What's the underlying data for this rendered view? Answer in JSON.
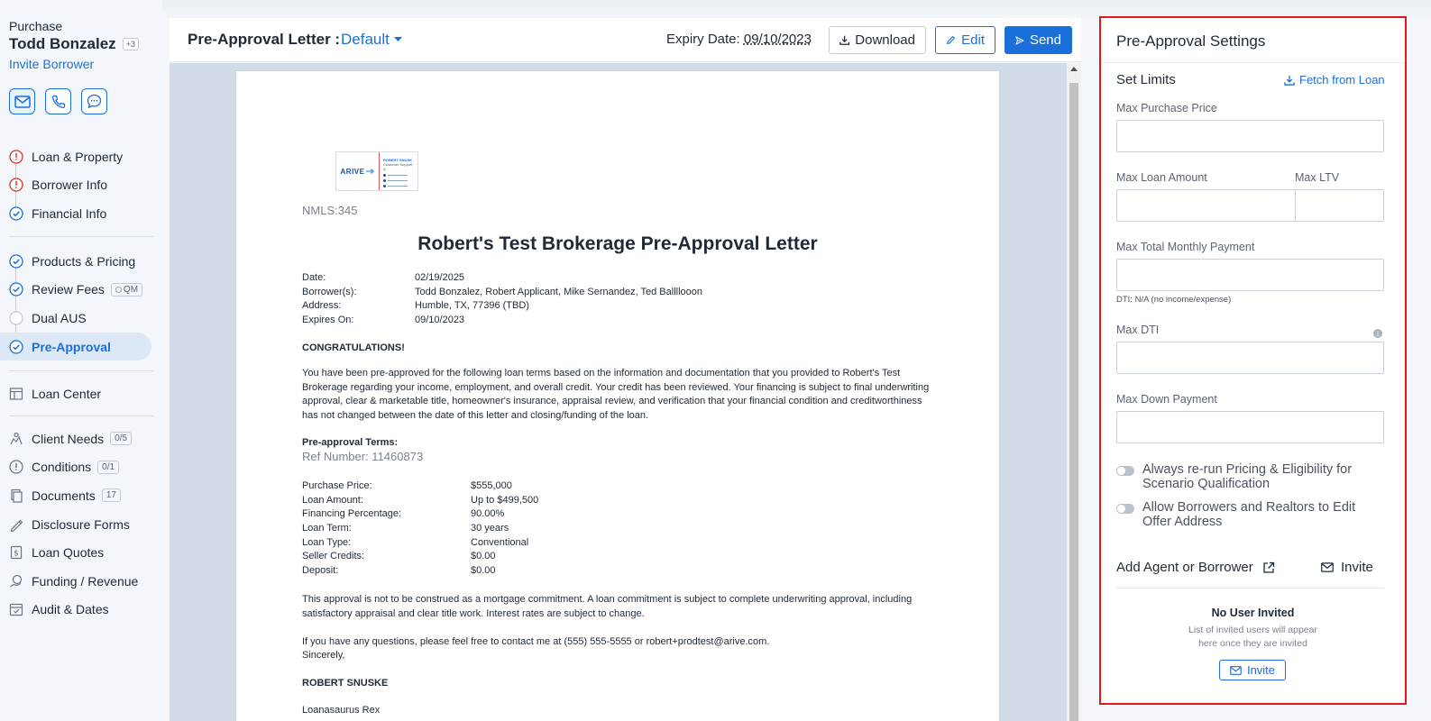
{
  "borrower": {
    "purpose": "Purchase",
    "name": "Todd Bonzalez",
    "extra_count": "+3",
    "invite_label": "Invite Borrower"
  },
  "contact_icons": [
    "mail-icon",
    "phone-icon",
    "chat-icon"
  ],
  "nav": {
    "group1": [
      {
        "label": "Loan & Property",
        "status": "warning"
      },
      {
        "label": "Borrower Info",
        "status": "warning"
      },
      {
        "label": "Financial Info",
        "status": "done"
      }
    ],
    "group2": [
      {
        "label": "Products & Pricing",
        "status": "done"
      },
      {
        "label": "Review Fees",
        "status": "done",
        "badge": "QM"
      },
      {
        "label": "Dual AUS",
        "status": "empty"
      },
      {
        "label": "Pre-Approval",
        "status": "done",
        "active": true
      }
    ],
    "loan_center": "Loan Center",
    "group3": [
      {
        "label": "Client Needs",
        "count": "0/5",
        "icon": "client-needs-icon"
      },
      {
        "label": "Conditions",
        "count": "0/1",
        "icon": "conditions-icon"
      },
      {
        "label": "Documents",
        "count": "17",
        "icon": "documents-icon"
      },
      {
        "label": "Disclosure Forms",
        "icon": "disclosure-icon"
      },
      {
        "label": "Loan Quotes",
        "icon": "loan-quotes-icon"
      },
      {
        "label": "Funding / Revenue",
        "icon": "funding-icon"
      },
      {
        "label": "Audit & Dates",
        "icon": "audit-icon"
      }
    ]
  },
  "header": {
    "title": "Pre-Approval Letter :",
    "template_value": "Default",
    "expiry_label": "Expiry Date:",
    "expiry_value": "09/10/2023",
    "download_label": "Download",
    "edit_label": "Edit",
    "send_label": "Send"
  },
  "letter": {
    "logo_text": "ARIVE",
    "card_name": "ROBERT SNUSK",
    "card_title": "Customer Support A",
    "nmls": "NMLS:345",
    "title": "Robert's Test Brokerage Pre-Approval Letter",
    "info": [
      {
        "k": "Date:",
        "v": "02/19/2025"
      },
      {
        "k": "Borrower(s):",
        "v": "Todd Bonzalez, Robert Applicant, Mike Sernandez, Ted Ballllooon"
      },
      {
        "k": "Address:",
        "v": "Humble, TX, 77396 (TBD)"
      },
      {
        "k": "Expires On:",
        "v": "09/10/2023"
      }
    ],
    "congrats": "CONGRATULATIONS!",
    "body1": "You have been pre-approved for the following loan terms based on the information and documentation that you provided to Robert's Test Brokerage regarding your income, employment, and overall credit. Your credit has been reviewed. Your financing is subject to final underwriting approval, clear & marketable title, homeowner's insurance, appraisal review, and verification that your financial condition and creditworthiness has not changed between the date of this letter and closing/funding of the loan.",
    "terms_heading": "Pre-approval Terms:",
    "ref_number": "Ref Number: 11460873",
    "terms": [
      {
        "k": "Purchase Price:",
        "v": "$555,000"
      },
      {
        "k": "Loan Amount:",
        "v": "Up to $499,500"
      },
      {
        "k": "Financing Percentage:",
        "v": "90.00%"
      },
      {
        "k": "Loan Term:",
        "v": "30 years"
      },
      {
        "k": "Loan Type:",
        "v": "Conventional"
      },
      {
        "k": "Seller Credits:",
        "v": "$0.00"
      },
      {
        "k": "Deposit:",
        "v": "$0.00"
      }
    ],
    "body2": "This approval is not to be construed as a mortgage commitment. A loan commitment is subject to complete underwriting approval, including satisfactory appraisal and clear title work. Interest rates are subject to change.",
    "body3": "If you have any questions, please feel free to contact me at (555) 555-5555 or robert+prodtest@arive.com.",
    "sincerely": "Sincerely,",
    "signer": "ROBERT SNUSKE",
    "signer_title": "Loanasaurus Rex"
  },
  "settings": {
    "title": "Pre-Approval Settings",
    "section": "Set Limits",
    "fetch_label": "Fetch from Loan",
    "max_purchase_price": {
      "label": "Max Purchase Price",
      "value": ""
    },
    "max_loan_amount": {
      "label": "Max Loan Amount",
      "value": ""
    },
    "max_ltv": {
      "label": "Max LTV",
      "value": ""
    },
    "max_total_monthly_payment": {
      "label": "Max Total Monthly Payment",
      "value": ""
    },
    "dti_hint": "DTI: N/A (no income/expense)",
    "max_dti": {
      "label": "Max DTI",
      "value": ""
    },
    "max_down_payment": {
      "label": "Max Down Payment",
      "value": ""
    },
    "toggle1": {
      "label": "Always re-run Pricing & Eligibility for Scenario Qualification",
      "on": false
    },
    "toggle2": {
      "label": "Allow Borrowers and Realtors to Edit Offer Address",
      "on": false
    },
    "add_agent_label": "Add Agent or Borrower",
    "invite_label": "Invite",
    "empty_title": "No User Invited",
    "empty_desc_line1": "List of invited users will appear",
    "empty_desc_line2": "here once they are invited",
    "empty_invite_label": "Invite"
  },
  "colors": {
    "accent": "#1a6fd8",
    "warning": "#d93025",
    "highlight_border": "#e3161b"
  }
}
